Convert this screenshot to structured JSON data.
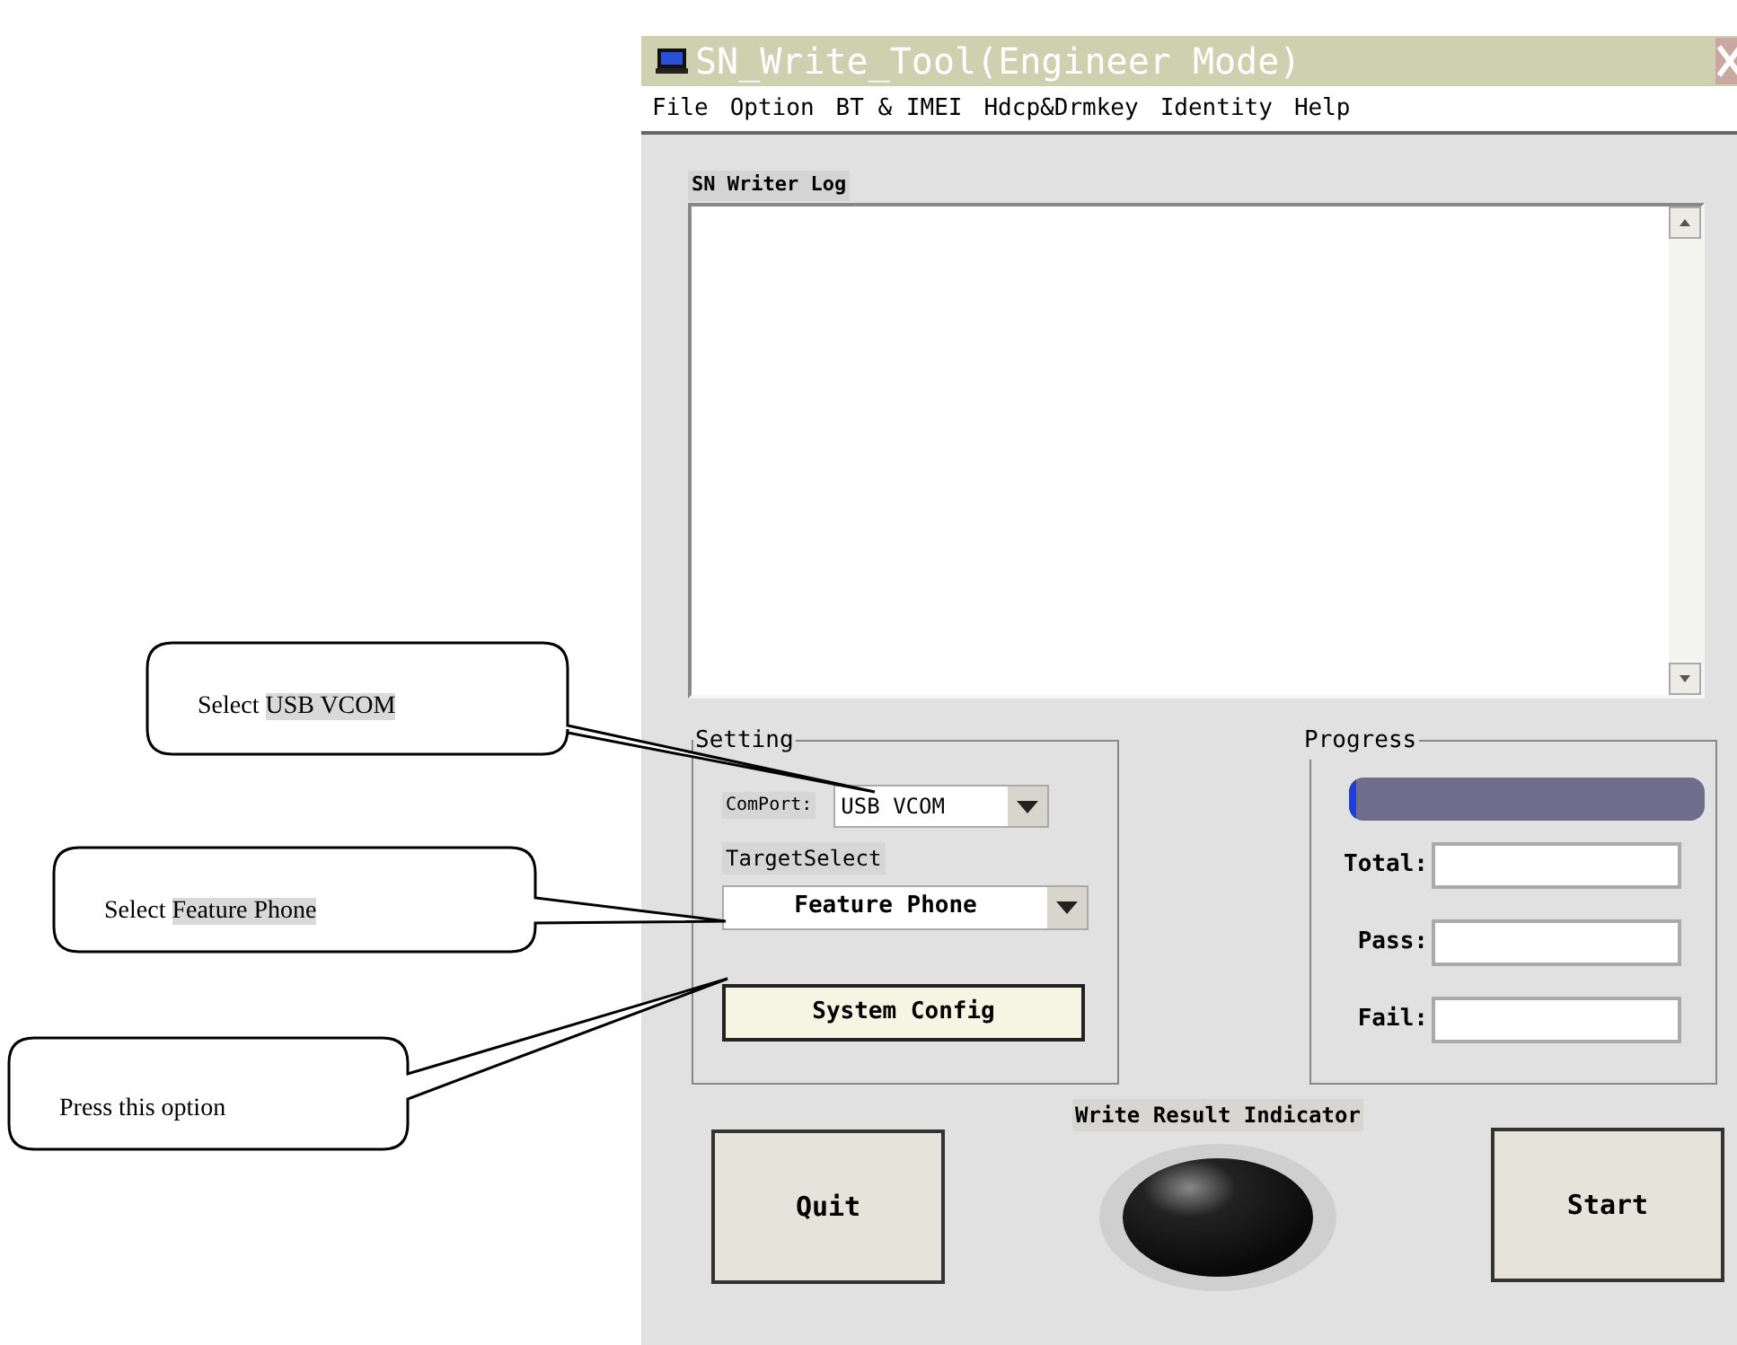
{
  "window": {
    "title": "SN_Write_Tool(Engineer Mode)"
  },
  "menu": [
    "File",
    "Option",
    "BT & IMEI",
    "Hdcp&Drmkey",
    "Identity",
    "Help"
  ],
  "log": {
    "label": "SN Writer Log"
  },
  "setting": {
    "label": "Setting",
    "comport_label": "ComPort:",
    "comport_value": "USB VCOM",
    "target_label": "TargetSelect",
    "target_value": "Feature Phone",
    "config_button": "System Config"
  },
  "progress": {
    "label": "Progress",
    "level": 0.02,
    "fields": [
      {
        "label": "Total:"
      },
      {
        "label": "Pass:"
      },
      {
        "label": "Fail:"
      }
    ]
  },
  "indicator": {
    "label": "Write Result Indicator"
  },
  "buttons": {
    "quit": "Quit",
    "start": "Start"
  },
  "callouts": [
    {
      "text": "Select",
      "highlight": "USB VCOM"
    },
    {
      "text": "Select",
      "highlight": "Feature Phone"
    },
    {
      "text": "Press this option"
    }
  ]
}
